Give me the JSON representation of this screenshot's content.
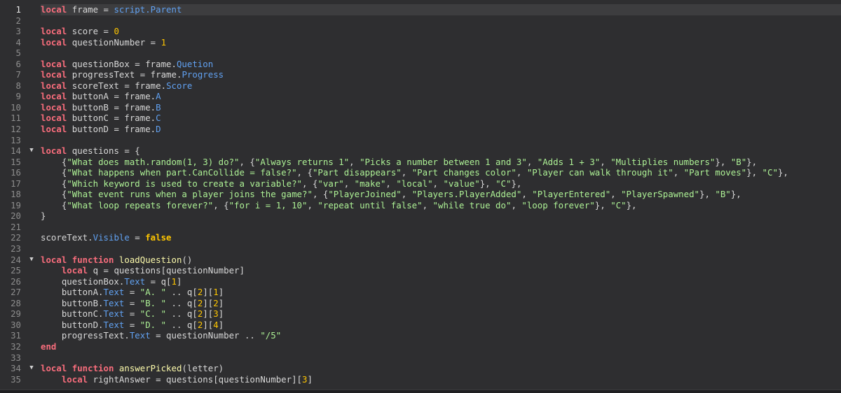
{
  "editor": {
    "current_line": 1,
    "lines": [
      {
        "n": "1",
        "fold": "",
        "tokens": [
          [
            "kw",
            "local"
          ],
          [
            "plain",
            " frame = "
          ],
          [
            "prop",
            "script.Parent"
          ]
        ]
      },
      {
        "n": "2",
        "fold": "",
        "tokens": []
      },
      {
        "n": "3",
        "fold": "",
        "tokens": [
          [
            "kw",
            "local"
          ],
          [
            "plain",
            " score = "
          ],
          [
            "num",
            "0"
          ]
        ]
      },
      {
        "n": "4",
        "fold": "",
        "tokens": [
          [
            "kw",
            "local"
          ],
          [
            "plain",
            " questionNumber = "
          ],
          [
            "num",
            "1"
          ]
        ]
      },
      {
        "n": "5",
        "fold": "",
        "tokens": []
      },
      {
        "n": "6",
        "fold": "",
        "tokens": [
          [
            "kw",
            "local"
          ],
          [
            "plain",
            " questionBox = frame."
          ],
          [
            "prop",
            "Quetion"
          ]
        ]
      },
      {
        "n": "7",
        "fold": "",
        "tokens": [
          [
            "kw",
            "local"
          ],
          [
            "plain",
            " progressText = frame."
          ],
          [
            "prop",
            "Progress"
          ]
        ]
      },
      {
        "n": "8",
        "fold": "",
        "tokens": [
          [
            "kw",
            "local"
          ],
          [
            "plain",
            " scoreText = frame."
          ],
          [
            "prop",
            "Score"
          ]
        ]
      },
      {
        "n": "9",
        "fold": "",
        "tokens": [
          [
            "kw",
            "local"
          ],
          [
            "plain",
            " buttonA = frame."
          ],
          [
            "prop",
            "A"
          ]
        ]
      },
      {
        "n": "10",
        "fold": "",
        "tokens": [
          [
            "kw",
            "local"
          ],
          [
            "plain",
            " buttonB = frame."
          ],
          [
            "prop",
            "B"
          ]
        ]
      },
      {
        "n": "11",
        "fold": "",
        "tokens": [
          [
            "kw",
            "local"
          ],
          [
            "plain",
            " buttonC = frame."
          ],
          [
            "prop",
            "C"
          ]
        ]
      },
      {
        "n": "12",
        "fold": "",
        "tokens": [
          [
            "kw",
            "local"
          ],
          [
            "plain",
            " buttonD = frame."
          ],
          [
            "prop",
            "D"
          ]
        ]
      },
      {
        "n": "13",
        "fold": "",
        "tokens": []
      },
      {
        "n": "14",
        "fold": "▼",
        "tokens": [
          [
            "kw",
            "local"
          ],
          [
            "plain",
            " questions = {"
          ]
        ]
      },
      {
        "n": "15",
        "fold": "",
        "tokens": [
          [
            "plain",
            "    {"
          ],
          [
            "str",
            "\"What does math.random(1, 3) do?\""
          ],
          [
            "plain",
            ", {"
          ],
          [
            "str",
            "\"Always returns 1\""
          ],
          [
            "plain",
            ", "
          ],
          [
            "str",
            "\"Picks a number between 1 and 3\""
          ],
          [
            "plain",
            ", "
          ],
          [
            "str",
            "\"Adds 1 + 3\""
          ],
          [
            "plain",
            ", "
          ],
          [
            "str",
            "\"Multiplies numbers\""
          ],
          [
            "plain",
            "}, "
          ],
          [
            "str",
            "\"B\""
          ],
          [
            "plain",
            "},"
          ]
        ]
      },
      {
        "n": "16",
        "fold": "",
        "tokens": [
          [
            "plain",
            "    {"
          ],
          [
            "str",
            "\"What happens when part.CanCollide = false?\""
          ],
          [
            "plain",
            ", {"
          ],
          [
            "str",
            "\"Part disappears\""
          ],
          [
            "plain",
            ", "
          ],
          [
            "str",
            "\"Part changes color\""
          ],
          [
            "plain",
            ", "
          ],
          [
            "str",
            "\"Player can walk through it\""
          ],
          [
            "plain",
            ", "
          ],
          [
            "str",
            "\"Part moves\""
          ],
          [
            "plain",
            "}, "
          ],
          [
            "str",
            "\"C\""
          ],
          [
            "plain",
            "},"
          ]
        ]
      },
      {
        "n": "17",
        "fold": "",
        "tokens": [
          [
            "plain",
            "    {"
          ],
          [
            "str",
            "\"Which keyword is used to create a variable?\""
          ],
          [
            "plain",
            ", {"
          ],
          [
            "str",
            "\"var\""
          ],
          [
            "plain",
            ", "
          ],
          [
            "str",
            "\"make\""
          ],
          [
            "plain",
            ", "
          ],
          [
            "str",
            "\"local\""
          ],
          [
            "plain",
            ", "
          ],
          [
            "str",
            "\"value\""
          ],
          [
            "plain",
            "}, "
          ],
          [
            "str",
            "\"C\""
          ],
          [
            "plain",
            "},"
          ]
        ]
      },
      {
        "n": "18",
        "fold": "",
        "tokens": [
          [
            "plain",
            "    {"
          ],
          [
            "str",
            "\"What event runs when a player joins the game?\""
          ],
          [
            "plain",
            ", {"
          ],
          [
            "str",
            "\"PlayerJoined\""
          ],
          [
            "plain",
            ", "
          ],
          [
            "str",
            "\"Players.PlayerAdded\""
          ],
          [
            "plain",
            ", "
          ],
          [
            "str",
            "\"PlayerEntered\""
          ],
          [
            "plain",
            ", "
          ],
          [
            "str",
            "\"PlayerSpawned\""
          ],
          [
            "plain",
            "}, "
          ],
          [
            "str",
            "\"B\""
          ],
          [
            "plain",
            "},"
          ]
        ]
      },
      {
        "n": "19",
        "fold": "",
        "tokens": [
          [
            "plain",
            "    {"
          ],
          [
            "str",
            "\"What loop repeats forever?\""
          ],
          [
            "plain",
            ", {"
          ],
          [
            "str",
            "\"for i = 1, 10\""
          ],
          [
            "plain",
            ", "
          ],
          [
            "str",
            "\"repeat until false\""
          ],
          [
            "plain",
            ", "
          ],
          [
            "str",
            "\"while true do\""
          ],
          [
            "plain",
            ", "
          ],
          [
            "str",
            "\"loop forever\""
          ],
          [
            "plain",
            "}, "
          ],
          [
            "str",
            "\"C\""
          ],
          [
            "plain",
            "},"
          ]
        ]
      },
      {
        "n": "20",
        "fold": "",
        "tokens": [
          [
            "plain",
            "}"
          ]
        ]
      },
      {
        "n": "21",
        "fold": "",
        "tokens": []
      },
      {
        "n": "22",
        "fold": "",
        "tokens": [
          [
            "plain",
            "scoreText."
          ],
          [
            "prop",
            "Visible"
          ],
          [
            "plain",
            " = "
          ],
          [
            "bool",
            "false"
          ]
        ]
      },
      {
        "n": "23",
        "fold": "",
        "tokens": []
      },
      {
        "n": "24",
        "fold": "▼",
        "tokens": [
          [
            "kw",
            "local function"
          ],
          [
            "plain",
            " "
          ],
          [
            "fn",
            "loadQuestion"
          ],
          [
            "plain",
            "()"
          ]
        ]
      },
      {
        "n": "25",
        "fold": "",
        "tokens": [
          [
            "plain",
            "    "
          ],
          [
            "kw",
            "local"
          ],
          [
            "plain",
            " q = questions[questionNumber]"
          ]
        ]
      },
      {
        "n": "26",
        "fold": "",
        "tokens": [
          [
            "plain",
            "    questionBox."
          ],
          [
            "prop",
            "Text"
          ],
          [
            "plain",
            " = q["
          ],
          [
            "num",
            "1"
          ],
          [
            "plain",
            "]"
          ]
        ]
      },
      {
        "n": "27",
        "fold": "",
        "tokens": [
          [
            "plain",
            "    buttonA."
          ],
          [
            "prop",
            "Text"
          ],
          [
            "plain",
            " = "
          ],
          [
            "str",
            "\"A. \""
          ],
          [
            "plain",
            " .. q["
          ],
          [
            "num",
            "2"
          ],
          [
            "plain",
            "]["
          ],
          [
            "num",
            "1"
          ],
          [
            "plain",
            "]"
          ]
        ]
      },
      {
        "n": "28",
        "fold": "",
        "tokens": [
          [
            "plain",
            "    buttonB."
          ],
          [
            "prop",
            "Text"
          ],
          [
            "plain",
            " = "
          ],
          [
            "str",
            "\"B. \""
          ],
          [
            "plain",
            " .. q["
          ],
          [
            "num",
            "2"
          ],
          [
            "plain",
            "]["
          ],
          [
            "num",
            "2"
          ],
          [
            "plain",
            "]"
          ]
        ]
      },
      {
        "n": "29",
        "fold": "",
        "tokens": [
          [
            "plain",
            "    buttonC."
          ],
          [
            "prop",
            "Text"
          ],
          [
            "plain",
            " = "
          ],
          [
            "str",
            "\"C. \""
          ],
          [
            "plain",
            " .. q["
          ],
          [
            "num",
            "2"
          ],
          [
            "plain",
            "]["
          ],
          [
            "num",
            "3"
          ],
          [
            "plain",
            "]"
          ]
        ]
      },
      {
        "n": "30",
        "fold": "",
        "tokens": [
          [
            "plain",
            "    buttonD."
          ],
          [
            "prop",
            "Text"
          ],
          [
            "plain",
            " = "
          ],
          [
            "str",
            "\"D. \""
          ],
          [
            "plain",
            " .. q["
          ],
          [
            "num",
            "2"
          ],
          [
            "plain",
            "]["
          ],
          [
            "num",
            "4"
          ],
          [
            "plain",
            "]"
          ]
        ]
      },
      {
        "n": "31",
        "fold": "",
        "tokens": [
          [
            "plain",
            "    progressText."
          ],
          [
            "prop",
            "Text"
          ],
          [
            "plain",
            " = questionNumber .. "
          ],
          [
            "str",
            "\"/5\""
          ]
        ]
      },
      {
        "n": "32",
        "fold": "",
        "tokens": [
          [
            "kw",
            "end"
          ]
        ]
      },
      {
        "n": "33",
        "fold": "",
        "tokens": []
      },
      {
        "n": "34",
        "fold": "▼",
        "tokens": [
          [
            "kw",
            "local function"
          ],
          [
            "plain",
            " "
          ],
          [
            "fn",
            "answerPicked"
          ],
          [
            "plain",
            "(letter)"
          ]
        ]
      },
      {
        "n": "35",
        "fold": "",
        "tokens": [
          [
            "plain",
            "    "
          ],
          [
            "kw",
            "local"
          ],
          [
            "plain",
            " rightAnswer = questions[questionNumber]["
          ],
          [
            "num",
            "3"
          ],
          [
            "plain",
            "]"
          ]
        ]
      }
    ]
  }
}
